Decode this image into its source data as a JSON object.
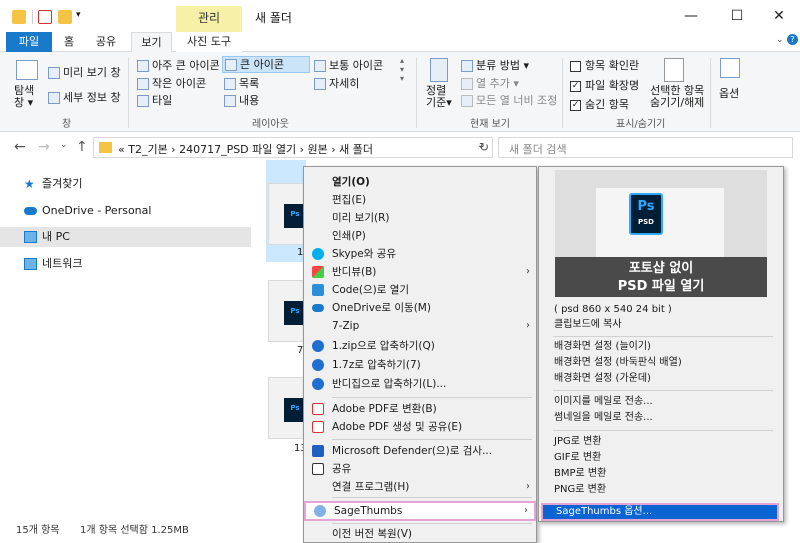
{
  "titlebar": {
    "manage_tab": "관리",
    "window_title": "새 폴더",
    "min": "—",
    "max": "☐",
    "close": "✕"
  },
  "tabs": {
    "file": "파일",
    "home": "홈",
    "share": "공유",
    "view": "보기",
    "photo_tools": "사진 도구"
  },
  "ribbon": {
    "nav_pane": "탐색\n창 ▾",
    "preview_pane": "미리 보기 창",
    "details_pane": "세부 정보 창",
    "group_pane": "창",
    "layout": {
      "xl_icons": "아주 큰 아이콘",
      "l_icons": "큰 아이콘",
      "m_icons": "보통 아이콘",
      "s_icons": "작은 아이콘",
      "list": "목록",
      "details": "자세히",
      "tiles": "타일",
      "content": "내용"
    },
    "group_layout": "레이아웃",
    "sort_by": "정렬\n기준▾",
    "group_by": "분류 방법 ▾",
    "add_columns": "열 추가 ▾",
    "size_all_columns": "모든 열 너비 조정",
    "group_current_view": "현재 보기",
    "item_checkboxes": "항목 확인란",
    "file_extensions": "파일 확장명",
    "hidden_items": "숨긴 항목",
    "hide_selected_1": "선택한 항목",
    "hide_selected_2": "숨기기/해제",
    "group_show_hide": "표시/숨기기",
    "options": "옵션",
    "check_mark": "✓"
  },
  "address": {
    "path": "«  T2_기본  ›  240717_PSD 파일 열기  ›  원본  ›  새 폴더",
    "search_placeholder": "새 폴더 검색",
    "back": "←",
    "forward": "→",
    "recent": "⌄",
    "up": "↑",
    "dropdown": "⌄",
    "refresh": "↻"
  },
  "nav_pane": {
    "items": [
      "즐겨찾기",
      "OneDrive - Personal",
      "내 PC",
      "네트워크"
    ]
  },
  "files": {
    "labels": [
      "1",
      "7",
      "13"
    ],
    "ps_text": "Ps"
  },
  "status": {
    "count": "15개 항목",
    "selected": "1개 항목 선택함 1.25MB"
  },
  "context_menu": {
    "items": [
      "열기(O)",
      "편집(E)",
      "미리 보기(R)",
      "인쇄(P)",
      "Skype와 공유",
      "반디뷰(B)",
      "Code(으)로 열기",
      "OneDrive로 이동(M)",
      "7-Zip",
      "1.zip으로 압축하기(Q)",
      "1.7z로 압축하기(7)",
      "반디집으로 압축하기(L)...",
      "Adobe PDF로 변환(B)",
      "Adobe PDF 생성 및 공유(E)",
      "Microsoft Defender(으)로 검사...",
      "공유",
      "연결 프로그램(H)",
      "SageThumbs",
      "이전 버전 복원(V)"
    ],
    "arrow": "›"
  },
  "submenu": {
    "ps_logo": "Ps",
    "ps_sub": "PSD",
    "banner_line1": "포토샵 없이",
    "banner_line2": "PSD 파일 열기",
    "items": [
      "( psd 860 x 540 24 bit )",
      "클립보드에 복사",
      "배경화면 설정 (늘이기)",
      "배경화면 설정 (바둑판식 배열)",
      "배경화면 설정 (가운데)",
      "이미지를 메일로 전송...",
      "썸네일을 메일로 전송...",
      "JPG로 변환",
      "GIF로 변환",
      "BMP로 변환",
      "PNG로 변환",
      "SageThumbs 옵션..."
    ]
  },
  "colors": {
    "accent": "#1979ca",
    "highlight": "#0a64d2",
    "highlight_border": "#e6a3d6",
    "manage_tab": "#f7f1a7",
    "photoshop_blue": "#31a8ff",
    "photoshop_bg": "#001e36"
  }
}
